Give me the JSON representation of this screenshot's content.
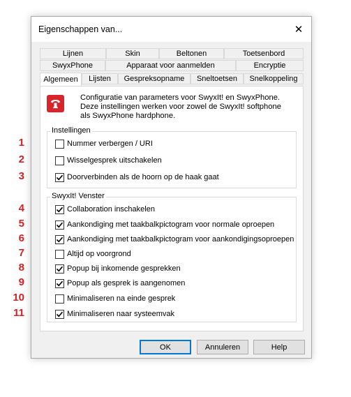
{
  "window": {
    "title": "Eigenschappen van...",
    "close_glyph": "✕"
  },
  "tabs": {
    "row1": [
      "Lijnen",
      "Skin",
      "Beltonen",
      "Toetsenbord"
    ],
    "row2": [
      "SwyxPhone",
      "Apparaat voor aanmelden",
      "Encryptie"
    ],
    "row3": [
      "Algemeen",
      "Lijsten",
      "Gespreksopname",
      "Sneltoetsen",
      "Snelkoppeling"
    ],
    "active": "Algemeen"
  },
  "info": {
    "icon": "swyx-phone-icon",
    "icon_color": "#d7252b",
    "text": "Configuratie van parameters voor SwyxIt! en SwyxPhone. Deze instellingen werken voor zowel de SwyxIt! softphone als SwyxPhone hardphone."
  },
  "groups": {
    "instellingen": {
      "legend": "Instellingen",
      "items": [
        {
          "num": "1",
          "label": "Nummer verbergen / URI",
          "checked": false
        },
        {
          "num": "2",
          "label": "Wisselgesprek uitschakelen",
          "checked": false
        },
        {
          "num": "3",
          "label": "Doorverbinden als de hoorn op de haak gaat",
          "checked": true
        }
      ]
    },
    "venster": {
      "legend": "SwyxIt! Venster",
      "items": [
        {
          "num": "4",
          "label": "Collaboration inschakelen",
          "checked": true
        },
        {
          "num": "5",
          "label": "Aankondiging met taakbalkpictogram voor normale oproepen",
          "checked": true
        },
        {
          "num": "6",
          "label": "Aankondiging met taakbalkpictogram voor aankondigingsoproepen",
          "checked": true
        },
        {
          "num": "7",
          "label": "Altijd op voorgrond",
          "checked": false
        },
        {
          "num": "8",
          "label": "Popup bij inkomende gesprekken",
          "checked": true
        },
        {
          "num": "9",
          "label": "Popup als gesprek is aangenomen",
          "checked": true
        },
        {
          "num": "10",
          "label": "Minimaliseren na einde gesprek",
          "checked": false
        },
        {
          "num": "11",
          "label": "Minimaliseren naar systeemvak",
          "checked": true
        }
      ]
    }
  },
  "annotation_color": "#d42025",
  "buttons": {
    "ok": "OK",
    "cancel": "Annuleren",
    "help": "Help"
  }
}
